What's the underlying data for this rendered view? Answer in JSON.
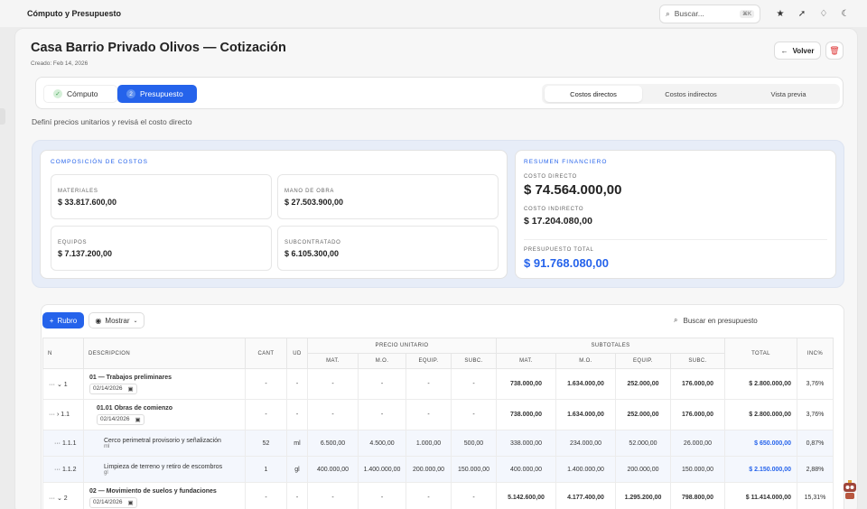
{
  "topbar": {
    "title": "Cómputo y Presupuesto",
    "search_placeholder": "Buscar...",
    "search_shortcut": "⌘K"
  },
  "header": {
    "title": "Casa Barrio Privado Olivos — Cotización",
    "created": "Creado: Feb 14, 2026",
    "back_label": "Volver"
  },
  "steps": [
    {
      "num": "✓",
      "label": "Cómputo"
    },
    {
      "num": "2",
      "label": "Presupuesto"
    }
  ],
  "segments": [
    "Costos directos",
    "Costos indirectos",
    "Vista previa"
  ],
  "subtitle": "Definí precios unitarios y revisá el costo directo",
  "composition": {
    "title": "COMPOSICIÓN DE COSTOS",
    "items": [
      {
        "label": "MATERIALES",
        "value": "$ 33.817.600,00"
      },
      {
        "label": "MANO DE OBRA",
        "value": "$ 27.503.900,00"
      },
      {
        "label": "EQUIPOS",
        "value": "$ 7.137.200,00"
      },
      {
        "label": "SUBCONTRATADO",
        "value": "$ 6.105.300,00"
      }
    ]
  },
  "summary": {
    "title": "RESUMEN FINANCIERO",
    "direct_label": "COSTO DIRECTO",
    "direct_value": "$ 74.564.000,00",
    "indirect_label": "COSTO INDIRECTO",
    "indirect_value": "$ 17.204.080,00",
    "total_label": "PRESUPUESTO TOTAL",
    "total_value": "$ 91.768.080,00",
    "accent": "#2563eb"
  },
  "toolbar": {
    "rubro_label": "Rubro",
    "mostrar_label": "Mostrar",
    "search_label": "Buscar en presupuesto"
  },
  "table": {
    "headers": {
      "n": "N",
      "desc": "DESCRIPCION",
      "cant": "CANT",
      "ud": "UD",
      "pu": "PRECIO UNITARIO",
      "sub": "SUBTOTALES",
      "total": "TOTAL",
      "inc": "INC%"
    },
    "sub_headers": [
      "MAT.",
      "M.O.",
      "EQUIP.",
      "SUBC.",
      "MAT.",
      "M.O.",
      "EQUIP.",
      "SUBC."
    ],
    "rows": [
      {
        "n": "1",
        "desc": "01 — Trabajos preliminares",
        "date": "02/14/2026",
        "cant": "-",
        "ud": "-",
        "pu": [
          "-",
          "-",
          "-",
          "-"
        ],
        "st": [
          "738.000,00",
          "1.634.000,00",
          "252.000,00",
          "176.000,00"
        ],
        "total": "$ 2.800.000,00",
        "inc": "3,76%"
      },
      {
        "n": "1.1",
        "desc": "01.01 Obras de comienzo",
        "date": "02/14/2026",
        "cant": "-",
        "ud": "-",
        "pu": [
          "-",
          "-",
          "-",
          "-"
        ],
        "st": [
          "738.000,00",
          "1.634.000,00",
          "252.000,00",
          "176.000,00"
        ],
        "total": "$ 2.800.000,00",
        "inc": "3,76%"
      },
      {
        "n": "1.1.1",
        "desc": "Cerco perimetral provisorio y señalización",
        "unit": "ml",
        "cant": "52",
        "ud": "ml",
        "pu": [
          "6.500,00",
          "4.500,00",
          "1.000,00",
          "500,00"
        ],
        "st": [
          "338.000,00",
          "234.000,00",
          "52.000,00",
          "26.000,00"
        ],
        "total": "$ 650.000,00",
        "inc": "0,87%"
      },
      {
        "n": "1.1.2",
        "desc": "Limpieza de terreno y retiro de escombros",
        "unit": "gl",
        "cant": "1",
        "ud": "gl",
        "pu": [
          "400.000,00",
          "1.400.000,00",
          "200.000,00",
          "150.000,00"
        ],
        "st": [
          "400.000,00",
          "1.400.000,00",
          "200.000,00",
          "150.000,00"
        ],
        "total": "$ 2.150.000,00",
        "inc": "2,88%"
      },
      {
        "n": "2",
        "desc": "02 — Movimiento de suelos y fundaciones",
        "date": "02/14/2026",
        "cant": "-",
        "ud": "-",
        "pu": [
          "-",
          "-",
          "-",
          "-"
        ],
        "st": [
          "5.142.600,00",
          "4.177.400,00",
          "1.295.200,00",
          "798.800,00"
        ],
        "total": "$ 11.414.000,00",
        "inc": "15,31%"
      }
    ]
  }
}
